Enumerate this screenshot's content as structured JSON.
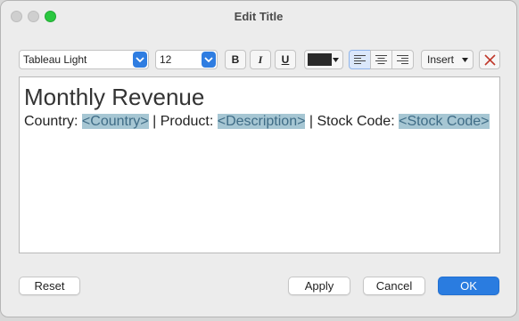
{
  "window": {
    "title": "Edit Title"
  },
  "toolbar": {
    "font": "Tableau Light",
    "size": "12",
    "bold_label": "B",
    "italic_label": "I",
    "underline_label": "U",
    "text_color": "#2b2b2b",
    "insert_label": "Insert"
  },
  "editor": {
    "heading": "Monthly Revenue",
    "line": {
      "country_label": "Country: ",
      "country_tag": "<Country>",
      "sep1": " | Product: ",
      "product_tag": "<Description>",
      "sep2": " | Stock Code: ",
      "stock_tag": "<Stock Code>"
    }
  },
  "buttons": {
    "reset": "Reset",
    "apply": "Apply",
    "cancel": "Cancel",
    "ok": "OK"
  }
}
